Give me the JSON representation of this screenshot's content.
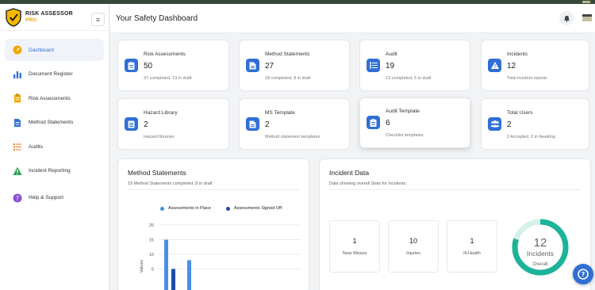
{
  "brand": {
    "name": "RISK ASSESSOR",
    "sub": "PRO"
  },
  "sidebar": {
    "items": [
      {
        "label": "Dashboard",
        "icon": "gauge-icon",
        "active": true
      },
      {
        "label": "Document Register",
        "icon": "bar-chart-icon"
      },
      {
        "label": "Risk Assessments",
        "icon": "clipboard-icon"
      },
      {
        "label": "Method Statements",
        "icon": "document-icon"
      },
      {
        "label": "Audits",
        "icon": "checklist-icon"
      },
      {
        "label": "Incident Reporting",
        "icon": "warning-icon"
      },
      {
        "label": "Help & Support",
        "icon": "help-icon"
      }
    ]
  },
  "header": {
    "title": "Your Safety Dashboard"
  },
  "stats": [
    {
      "title": "Risk Assessments",
      "value": "50",
      "desc": "37 completed, 13 in draft",
      "icon": "clipboard-icon"
    },
    {
      "title": "Method Statements",
      "value": "27",
      "desc": "18 completed, 8 in draft",
      "icon": "document-icon"
    },
    {
      "title": "Audit",
      "value": "19",
      "desc": "13 completed, 6 in draft",
      "icon": "list-icon"
    },
    {
      "title": "Incidents",
      "value": "12",
      "desc": "Total incident reports",
      "icon": "warning-icon"
    },
    {
      "title": "Hazard Library",
      "value": "2",
      "desc": "Hazard libraries",
      "icon": "book-icon"
    },
    {
      "title": "MS Template",
      "value": "2",
      "desc": "Method statement templates",
      "icon": "document-icon"
    },
    {
      "title": "Audit Template",
      "value": "6",
      "desc": "Checklist templates",
      "icon": "clipboard-icon"
    },
    {
      "title": "Total Users",
      "value": "2",
      "desc": "2 Accepted, 0 in Awaiting",
      "icon": "users-icon"
    }
  ],
  "ms_panel": {
    "title": "Method Statements",
    "subtitle": "19 Method Statements completed, 8 in draft"
  },
  "chart_data": {
    "type": "bar",
    "ylabel": "Values",
    "ylim": [
      0,
      20
    ],
    "yticks": [
      "20",
      "15",
      "10",
      "5"
    ],
    "series": [
      {
        "name": "Assessments in Place",
        "color": "#4a8ee6",
        "values": [
          15,
          8
        ]
      },
      {
        "name": "Assessments Signed Off",
        "color": "#1e4ca8",
        "values": [
          5
        ]
      }
    ]
  },
  "incident_panel": {
    "title": "Incident Data",
    "subtitle": "Data showing overall Stats for incidents.",
    "cards": [
      {
        "value": "1",
        "label": "Near Misses"
      },
      {
        "value": "10",
        "label": "Injuries"
      },
      {
        "value": "1",
        "label": "Ill-Health"
      }
    ],
    "ring": {
      "value": "12",
      "label1": "Incidents",
      "label2": "Overall",
      "fill": 0.8
    }
  }
}
